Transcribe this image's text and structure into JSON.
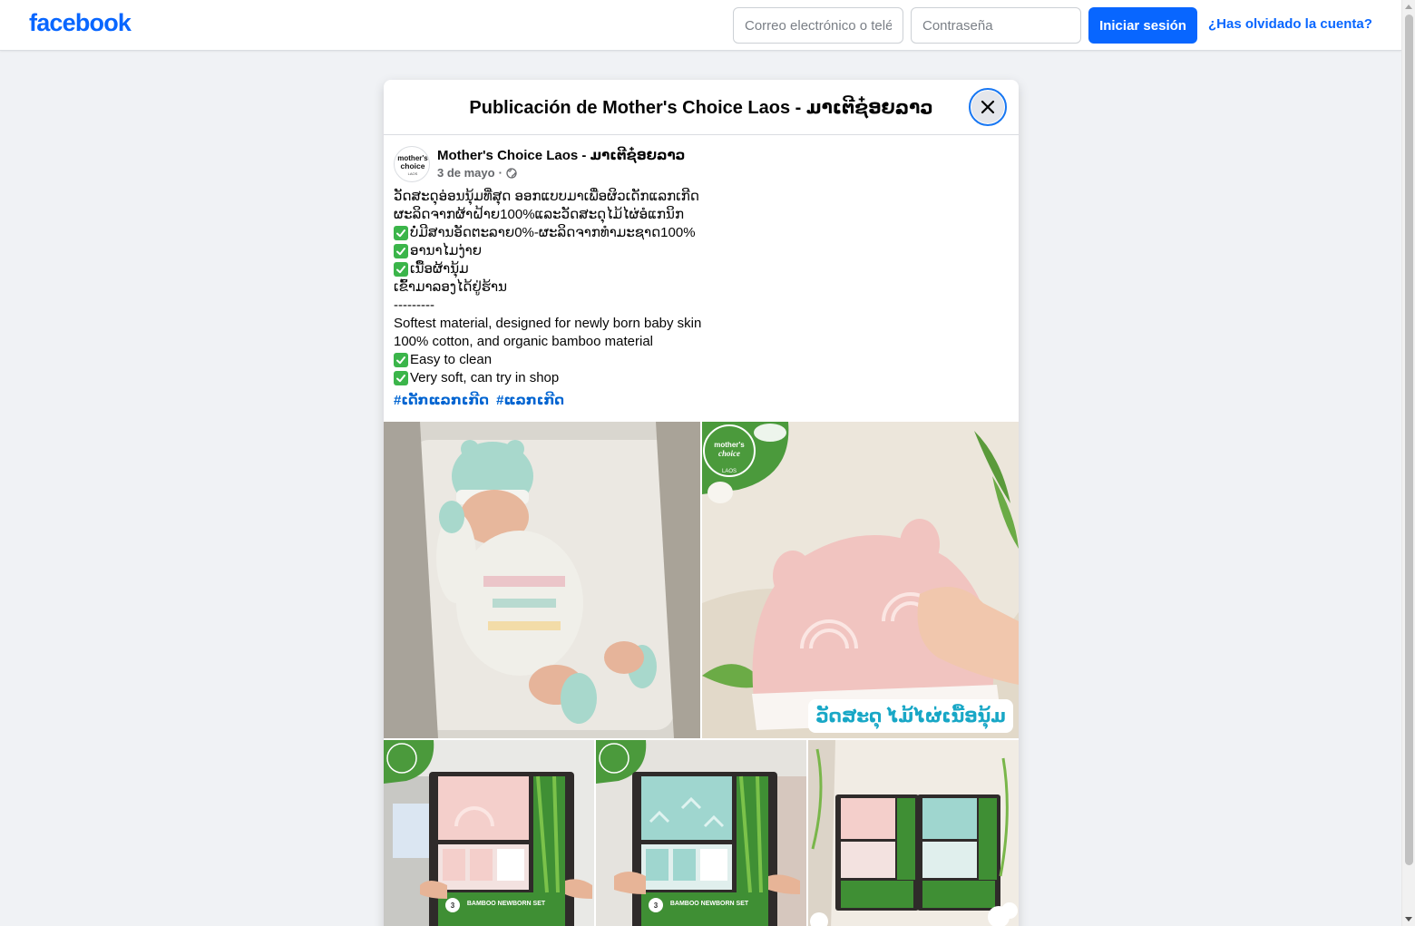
{
  "topbar": {
    "logo": "facebook",
    "email_placeholder": "Correo electrónico o teléfono",
    "password_placeholder": "Contraseña",
    "login_label": "Iniciar sesión",
    "forgot_label": "¿Has olvidado la cuenta?",
    "brand_color": "#0866ff"
  },
  "dialog": {
    "title": "Publicación de Mother's Choice Laos - ມາເຕີຊ໋ອຍລາວ",
    "close_icon": "close-icon"
  },
  "post": {
    "author": "Mother's Choice Laos - ມາເຕີຊ໋ອຍລາວ",
    "avatar_text": [
      "mother's",
      "choice",
      "LAOS"
    ],
    "date": "3 de mayo",
    "separator": "·",
    "privacy_icon": "globe-icon",
    "lines": [
      {
        "check": false,
        "text": "ວັດສະດຸອ່ອນນຸ້ມທີ່ສຸດ ອອກແບບມາເພື່ອຜິວເດັກແລກເກີດ"
      },
      {
        "check": false,
        "text": "ຜະລິດຈາກຜ້າຝ້າຍ100%ແລະວັດສະດຸໄມ້ໄຜ່ອໍແກນິກ"
      },
      {
        "check": true,
        "text": "ບໍ່ມີສານອັດຕະລາຍ0%-ຜະລິດຈາກທຳມະຊາດ100%"
      },
      {
        "check": true,
        "text": "ອານາໄມງ່າຍ"
      },
      {
        "check": true,
        "text": "ເນື້ອຜ້ານຸ້ມ"
      },
      {
        "check": false,
        "text": "ເຂົ້າມາລອງໄດ້ຢູ່ຮ້ານ"
      },
      {
        "check": false,
        "text": "---------"
      },
      {
        "check": false,
        "text": "Softest material, designed for newly born baby skin"
      },
      {
        "check": false,
        "text": "100% cotton, and organic bamboo material"
      },
      {
        "check": true,
        "text": "Easy to clean"
      },
      {
        "check": true,
        "text": "Very soft, can try in shop"
      }
    ],
    "hashtags": [
      "#ເດັກແລກເກີດ",
      "#ແລກເກີດ"
    ],
    "photos": {
      "photo2_caption": "ວັດສະດຸ ໄມ້ໄຜ່ເນື້ອນຸ້ມ",
      "brand_badge": [
        "mother's",
        "choice",
        "LAOS"
      ],
      "box_label": "BAMBOO NEWBORN SET",
      "pack_count": "3"
    }
  },
  "colors": {
    "page_bg": "#f0f2f5",
    "link": "#0064d1",
    "check_green": "#3bb54a"
  }
}
